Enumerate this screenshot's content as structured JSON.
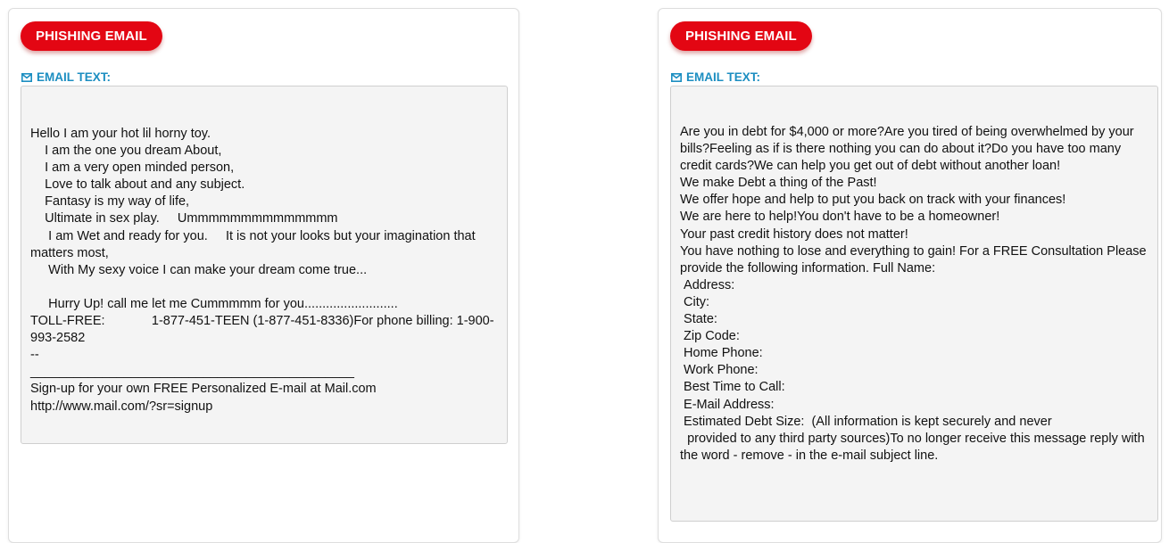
{
  "colors": {
    "badge_background": "#e30613",
    "label_text": "#1c8ec1",
    "email_box_background": "#f4f4f4"
  },
  "icons": {
    "email_label_icon": "envelope-icon"
  },
  "cards": [
    {
      "badge": "PHISHING EMAIL",
      "label": "EMAIL TEXT:",
      "email_text": "Hello I am your hot lil horny toy.\n    I am the one you dream About,\n    I am a very open minded person,\n    Love to talk about and any subject.\n    Fantasy is my way of life,\n    Ultimate in sex play.     Ummmmmmmmmmmmmm\n     I am Wet and ready for you.     It is not your looks but your imagination that matters most,\n     With My sexy voice I can make your dream come true...\n\n     Hurry Up! call me let me Cummmmm for you..........................\nTOLL-FREE:             1-877-451-TEEN (1-877-451-8336)For phone billing: 1-900-993-2582\n--\n_____________________________________________\nSign-up for your own FREE Personalized E-mail at Mail.com\nhttp://www.mail.com/?sr=signup"
    },
    {
      "badge": "PHISHING EMAIL",
      "label": "EMAIL TEXT:",
      "email_text": "Are you in debt for $4,000 or more?Are you tired of being overwhelmed by your bills?Feeling as if is there nothing you can do about it?Do you have too many credit cards?We can help you get out of debt without another loan!\nWe make Debt a thing of the Past!\nWe offer hope and help to put you back on track with your finances!\nWe are here to help!You don't have to be a homeowner!\nYour past credit history does not matter!\nYou have nothing to lose and everything to gain! For a FREE Consultation Please provide the following information. Full Name:\n Address:\n City:\n State:\n Zip Code:\n Home Phone:\n Work Phone:\n Best Time to Call:\n E-Mail Address:\n Estimated Debt Size:  (All information is kept securely and never\n  provided to any third party sources)To no longer receive this message reply with the word - remove - in the e-mail subject line."
    }
  ]
}
